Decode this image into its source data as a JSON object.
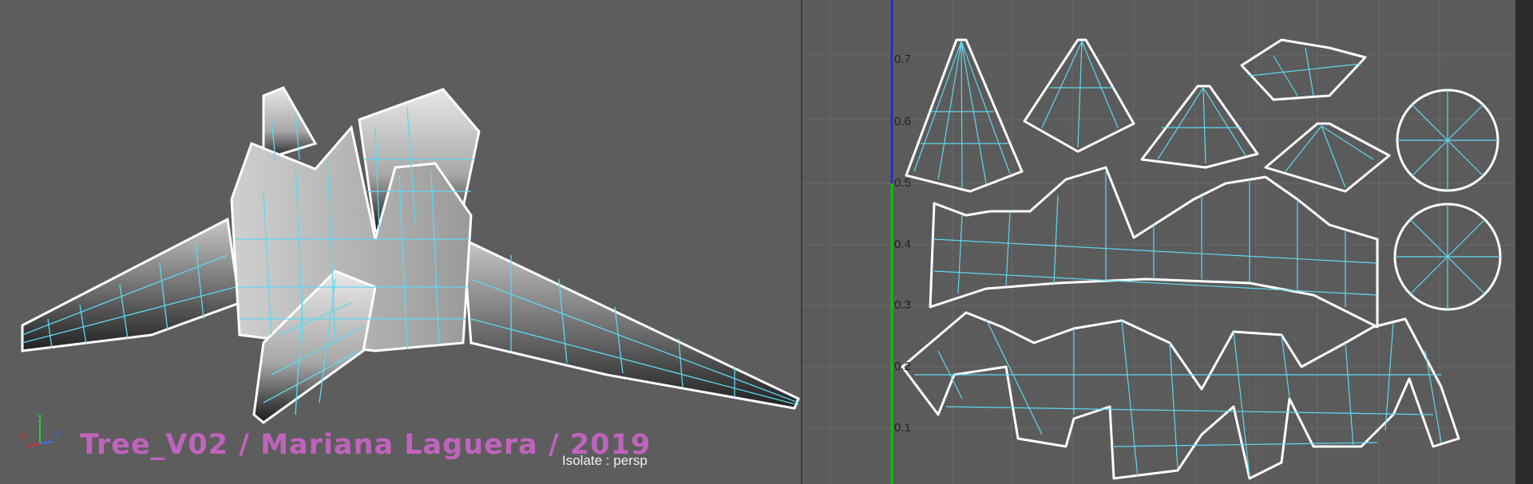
{
  "viewport": {
    "overlay_title": "Tree_V02 / Mariana Laguera / 2019",
    "isolate_label": "Isolate : persp",
    "axis": {
      "x": "x",
      "y": "y",
      "z": "z"
    }
  },
  "uv_editor": {
    "v_ticks": [
      "0.1",
      "0.2",
      "0.3",
      "0.4",
      "0.5",
      "0.6",
      "0.7"
    ],
    "colors": {
      "wire": "#5fd8f0",
      "border": "#ffffff",
      "grid": "#6a6a6a",
      "u_axis": "#00c800",
      "v_axis": "#2030c0"
    }
  },
  "colors": {
    "title": "#c063bd",
    "wire": "#5fd8f0",
    "viewport_bg": "#5d5d5d"
  }
}
